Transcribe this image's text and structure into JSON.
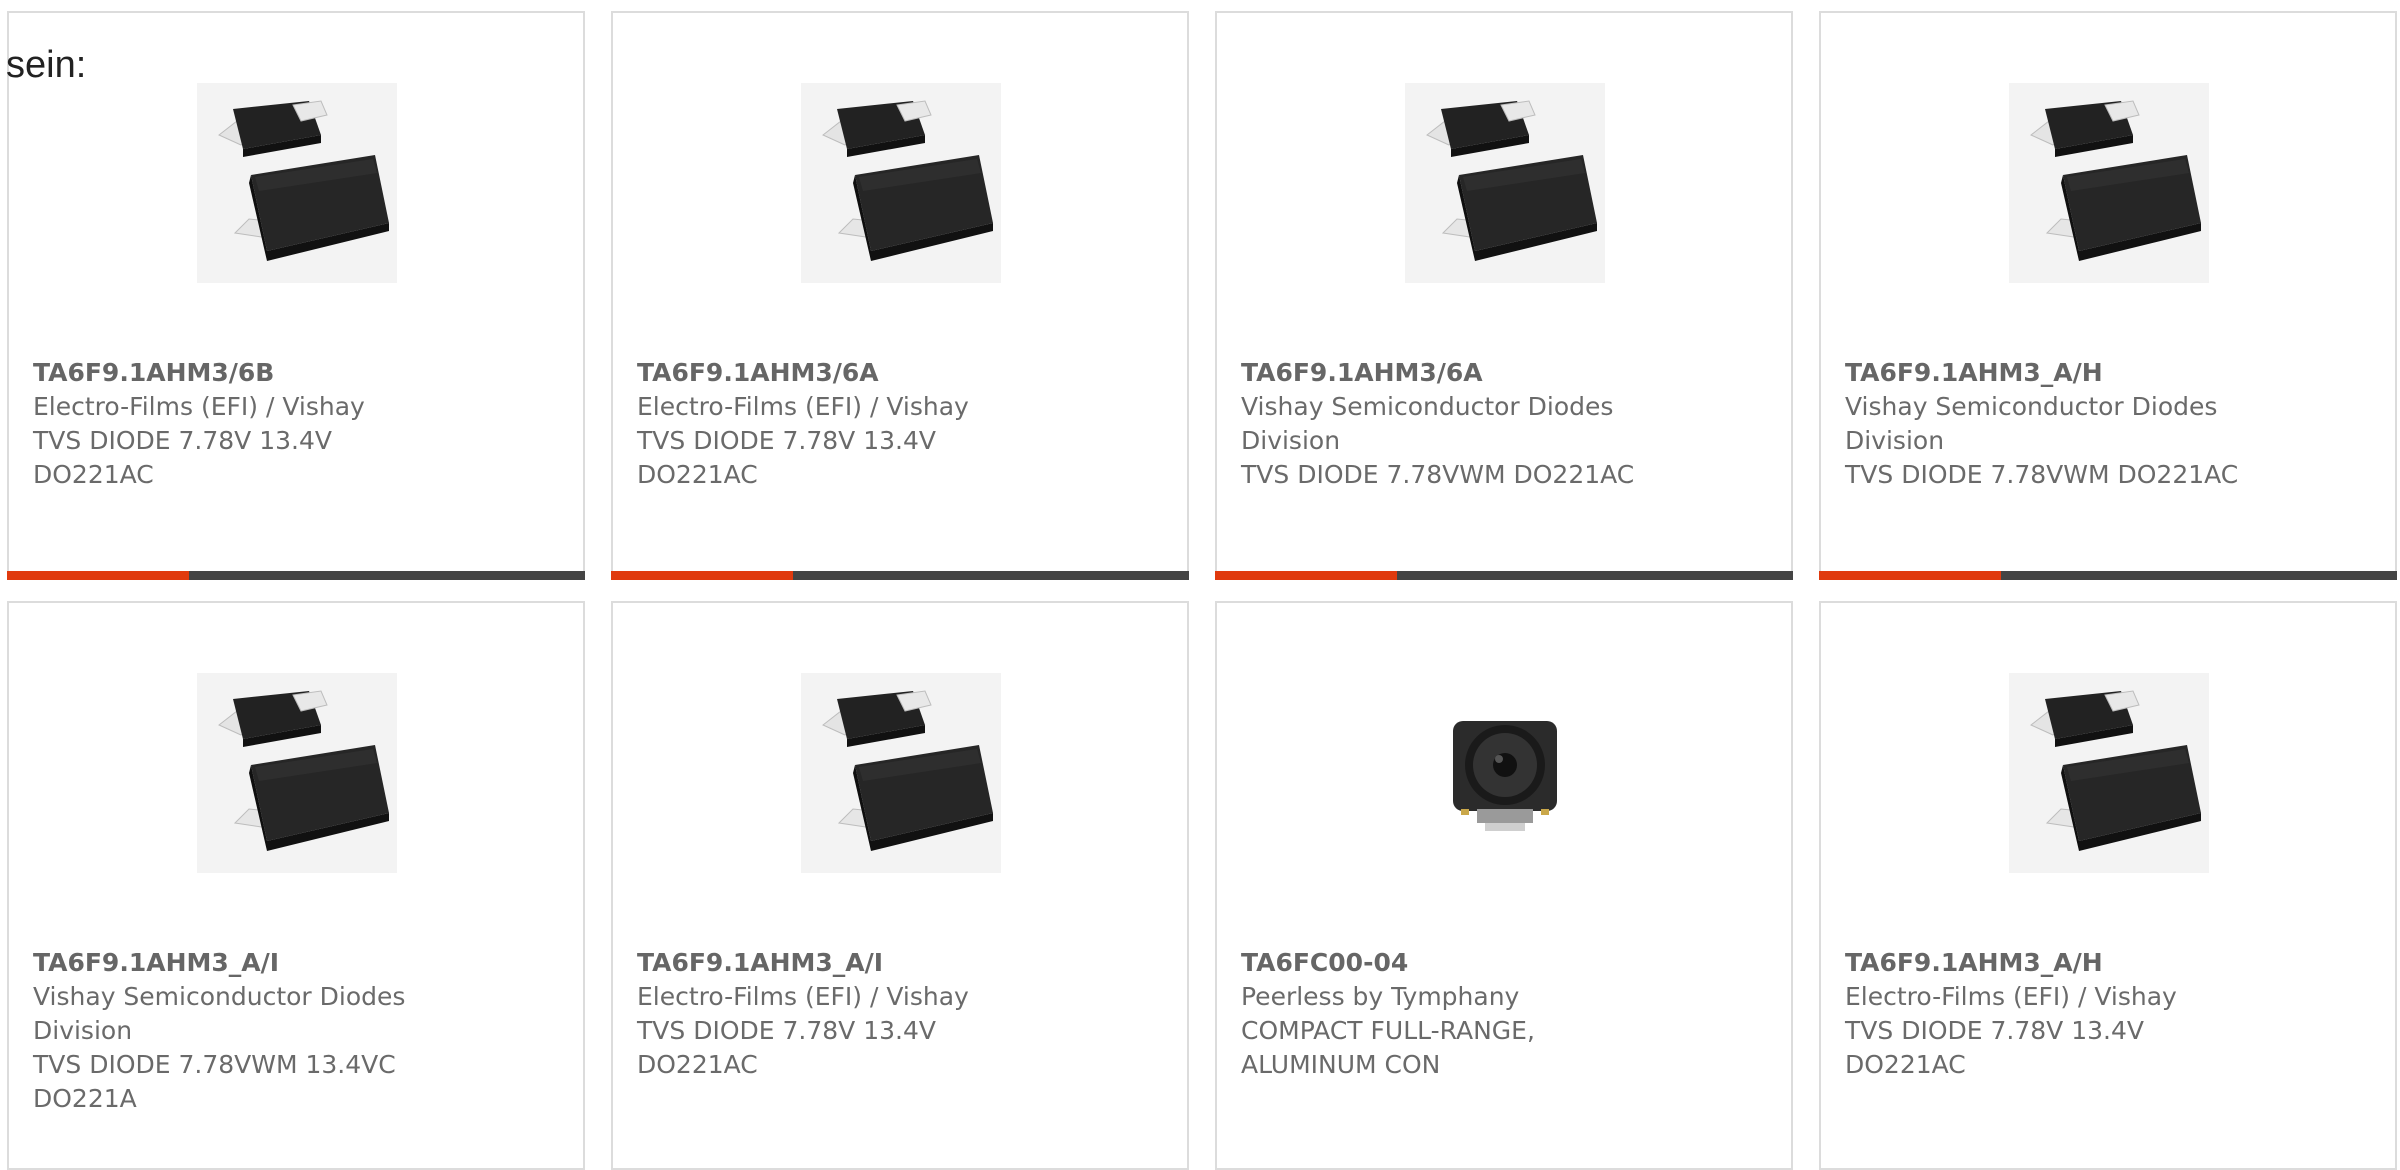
{
  "intro_text": "sein:",
  "colors": {
    "accent": "#e03a0e",
    "bar": "#444444",
    "border": "#dcdcdc"
  },
  "products": [
    {
      "part_number": "TA6F9.1AHM3/6B",
      "manufacturer": "Electro-Films (EFI) / Vishay",
      "description": "TVS DIODE 7.78V 13.4V DO221AC",
      "image": "diode-package-icon"
    },
    {
      "part_number": "TA6F9.1AHM3/6A",
      "manufacturer": "Electro-Films (EFI) / Vishay",
      "description": "TVS DIODE 7.78V 13.4V DO221AC",
      "image": "diode-package-icon"
    },
    {
      "part_number": "TA6F9.1AHM3/6A",
      "manufacturer": "Vishay Semiconductor Diodes Division",
      "description": "TVS DIODE 7.78VWM DO221AC",
      "image": "diode-package-icon"
    },
    {
      "part_number": "TA6F9.1AHM3_A/H",
      "manufacturer": "Vishay Semiconductor Diodes Division",
      "description": "TVS DIODE 7.78VWM DO221AC",
      "image": "diode-package-icon"
    },
    {
      "part_number": "TA6F9.1AHM3_A/I",
      "manufacturer": "Vishay Semiconductor Diodes Division",
      "description": "TVS DIODE 7.78VWM 13.4VC DO221A",
      "image": "diode-package-icon"
    },
    {
      "part_number": "TA6F9.1AHM3_A/I",
      "manufacturer": "Electro-Films (EFI) / Vishay",
      "description": "TVS DIODE 7.78V 13.4V DO221AC",
      "image": "diode-package-icon"
    },
    {
      "part_number": "TA6FC00-04",
      "manufacturer": "Peerless by Tymphany",
      "description": "COMPACT FULL-RANGE, ALUMINUM CON",
      "image": "speaker-driver-icon"
    },
    {
      "part_number": "TA6F9.1AHM3_A/H",
      "manufacturer": "Electro-Films (EFI) / Vishay",
      "description": "TVS DIODE 7.78V 13.4V DO221AC",
      "image": "diode-package-icon"
    }
  ]
}
